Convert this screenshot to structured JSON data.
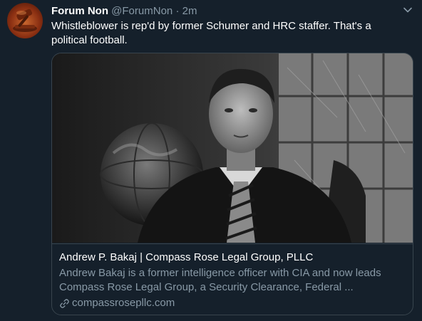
{
  "tweet": {
    "display_name": "Forum Non",
    "handle": "@ForumNon",
    "separator": "·",
    "time": "2m",
    "text": "Whistleblower is rep'd by former Schumer and HRC staffer.  That's a political football."
  },
  "card": {
    "title": "Andrew P. Bakaj | Compass Rose Legal Group, PLLC",
    "description": "Andrew Bakaj is a former intelligence officer with CIA and now leads Compass Rose Legal Group, a Security Clearance, Federal ...",
    "domain": "compassrosepllc.com"
  },
  "icons": {
    "avatar": "gavel-avatar",
    "menu": "chevron-down-icon",
    "link": "link-icon"
  },
  "colors": {
    "background": "#15202b",
    "text_primary": "#ffffff",
    "text_secondary": "#8899a6",
    "border": "#38444d"
  }
}
